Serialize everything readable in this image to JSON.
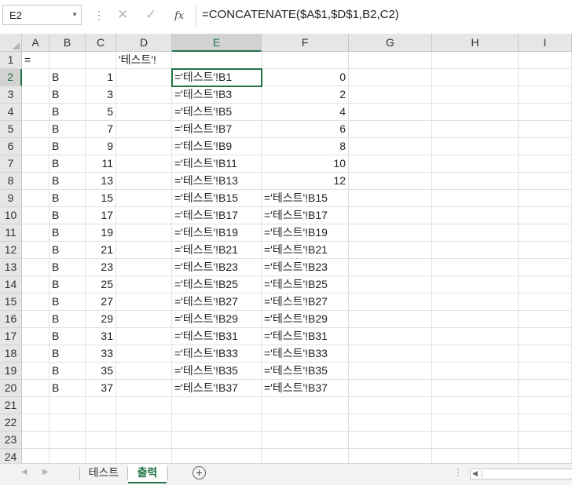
{
  "formula_bar": {
    "name_box": "E2",
    "formula": "=CONCATENATE($A$1,$D$1,B2,C2)",
    "cancel_icon": "✕",
    "enter_icon": "✓",
    "fx_icon": "fx"
  },
  "columns": [
    "A",
    "B",
    "C",
    "D",
    "E",
    "F",
    "G",
    "H",
    "I"
  ],
  "selected_column": "E",
  "rows": [
    "1",
    "2",
    "3",
    "4",
    "5",
    "6",
    "7",
    "8",
    "9",
    "10",
    "11",
    "12",
    "13",
    "14",
    "15",
    "16",
    "17",
    "18",
    "19",
    "20",
    "21",
    "22",
    "23",
    "24"
  ],
  "selected_row": "2",
  "cells": {
    "A1": "=",
    "D1": "'테스트'!",
    "B": [
      "B",
      "B",
      "B",
      "B",
      "B",
      "B",
      "B",
      "B",
      "B",
      "B",
      "B",
      "B",
      "B",
      "B",
      "B",
      "B",
      "B",
      "B",
      "B"
    ],
    "C": [
      "1",
      "3",
      "5",
      "7",
      "9",
      "11",
      "13",
      "15",
      "17",
      "19",
      "21",
      "23",
      "25",
      "27",
      "29",
      "31",
      "33",
      "35",
      "37"
    ],
    "E": [
      "='테스트'!B1",
      "='테스트'!B3",
      "='테스트'!B5",
      "='테스트'!B7",
      "='테스트'!B9",
      "='테스트'!B11",
      "='테스트'!B13",
      "='테스트'!B15",
      "='테스트'!B17",
      "='테스트'!B19",
      "='테스트'!B21",
      "='테스트'!B23",
      "='테스트'!B25",
      "='테스트'!B27",
      "='테스트'!B29",
      "='테스트'!B31",
      "='테스트'!B33",
      "='테스트'!B35",
      "='테스트'!B37"
    ],
    "F": [
      "0",
      "2",
      "4",
      "6",
      "8",
      "10",
      "12",
      "='테스트'!B15",
      "='테스트'!B17",
      "='테스트'!B19",
      "='테스트'!B21",
      "='테스트'!B23",
      "='테스트'!B25",
      "='테스트'!B27",
      "='테스트'!B29",
      "='테스트'!B31",
      "='테스트'!B33",
      "='테스트'!B35",
      "='테스트'!B37"
    ]
  },
  "sheet_tabs": [
    {
      "label": "테스트",
      "active": false
    },
    {
      "label": "출력",
      "active": true
    }
  ],
  "colors": {
    "accent": "#217346",
    "header_bg": "#e6e6e6",
    "gridline": "#e1e1e1"
  }
}
